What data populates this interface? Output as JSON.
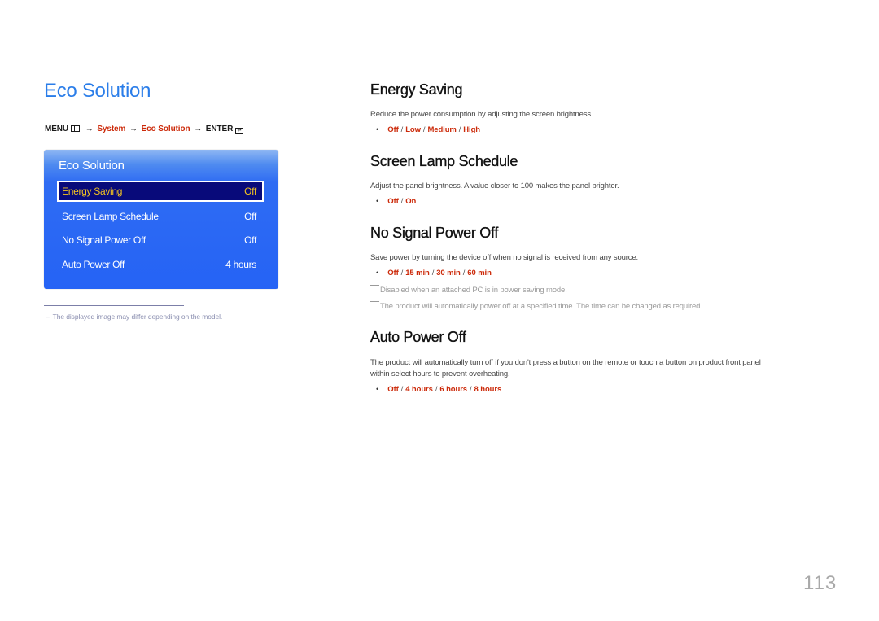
{
  "page": {
    "title": "Eco Solution",
    "number": "113"
  },
  "breadcrumb": {
    "menu": "MENU",
    "menu_icon": "menu-grid-icon",
    "arrow": "→",
    "system": "System",
    "eco": "Eco Solution",
    "enter": "ENTER",
    "enter_icon": "enter-icon",
    "enter_glyph": "↵"
  },
  "osd": {
    "title": "Eco Solution",
    "colors": {
      "panel": "#2563f5",
      "selected_bg": "#080a7a",
      "selected_text": "#f3c321"
    },
    "items": [
      {
        "label": "Energy Saving",
        "value": "Off",
        "selected": true
      },
      {
        "label": "Screen Lamp Schedule",
        "value": "Off",
        "selected": false
      },
      {
        "label": "No Signal Power Off",
        "value": "Off",
        "selected": false
      },
      {
        "label": "Auto Power Off",
        "value": "4 hours",
        "selected": false
      }
    ]
  },
  "footnote": {
    "dash": "–",
    "text": "The displayed image may differ depending on the model."
  },
  "sections": [
    {
      "title": "Energy Saving",
      "description": "Reduce the power consumption by adjusting the screen brightness.",
      "options": [
        "Off",
        "Low",
        "Medium",
        "High"
      ]
    },
    {
      "title": "Screen Lamp Schedule",
      "description": "Adjust the panel brightness. A value closer to 100 makes the panel brighter.",
      "options": [
        "Off",
        "On"
      ]
    },
    {
      "title": "No Signal Power Off",
      "description": "Save power by turning the device off when no signal is received from any source.",
      "options": [
        "Off",
        "15 min",
        "30 min",
        "60 min"
      ],
      "notes": [
        "Disabled when an attached PC is in power saving mode.",
        "The product will automatically power off at a specified time. The time can be changed as required."
      ]
    },
    {
      "title": "Auto Power Off",
      "description_lines": [
        "The product will automatically turn off if you don't press a button on the remote or touch a button on product front panel",
        "within select hours to prevent overheating."
      ],
      "options": [
        "Off",
        "4 hours",
        "6 hours",
        "8 hours"
      ]
    }
  ],
  "bullet": "•",
  "option_separator": "/",
  "colors": {
    "title_blue": "#2a7de9",
    "highlight_red": "#cc2a0a"
  }
}
